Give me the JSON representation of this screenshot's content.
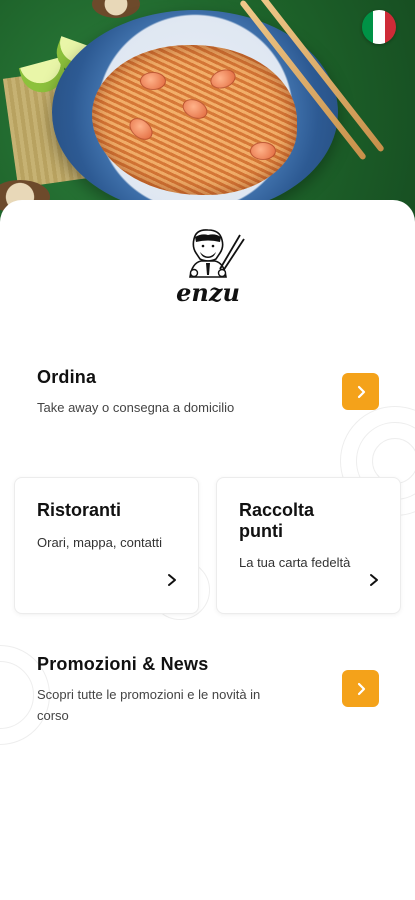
{
  "language": {
    "flag_colors": [
      "#009246",
      "#ffffff",
      "#ce2b37"
    ]
  },
  "brand": {
    "logo_text": "enzu"
  },
  "ordina": {
    "title": "Ordina",
    "subtitle": "Take away o consegna a domicilio"
  },
  "ristoranti": {
    "title": "Ristoranti",
    "subtitle": "Orari, mappa, contatti"
  },
  "raccolta": {
    "title_line1": "Raccolta",
    "title_line2": "punti",
    "subtitle": "La tua carta fedeltà"
  },
  "promozioni": {
    "title": "Promozioni & News",
    "subtitle_line1": "Scopri tutte le promozioni e le novità in",
    "subtitle_line2": "corso"
  },
  "colors": {
    "accent": "#f4a21a"
  }
}
